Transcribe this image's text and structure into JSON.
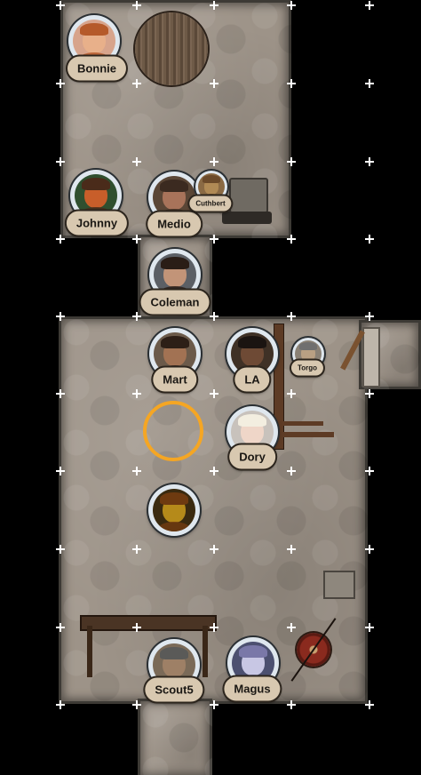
{
  "tokens": [
    {
      "name": "Bonnie",
      "skin": "#e8b08a",
      "hair": "#b55a2a",
      "bg": "#d7a48c"
    },
    {
      "name": "Johnny",
      "skin": "#c85e2a",
      "hair": "#4a2b1a",
      "bg": "#2f4f2f"
    },
    {
      "name": "Medio",
      "skin": "#a8735a",
      "hair": "#3b2a20",
      "bg": "#5a4636"
    },
    {
      "name": "Cuthbert",
      "skin": "#b08a55",
      "hair": "#6b4a2a",
      "bg": "#8a6a44"
    },
    {
      "name": "Coleman",
      "skin": "#c29478",
      "hair": "#2a1d16",
      "bg": "#5b5f65"
    },
    {
      "name": "Mart",
      "skin": "#a27253",
      "hair": "#2d1f17",
      "bg": "#6b5a4a"
    },
    {
      "name": "LA",
      "skin": "#6e4a35",
      "hair": "#1b1411",
      "bg": "#3f3126"
    },
    {
      "name": "Torgo",
      "skin": "#b9a083",
      "hair": "#6f6f6f",
      "bg": "#8a8175"
    },
    {
      "name": "Dory",
      "skin": "#efd6c8",
      "hair": "#f3eee0",
      "bg": "#c8c2bc"
    },
    {
      "name": "Scout5",
      "skin": "#9e8066",
      "hair": "#5a5a58",
      "bg": "#7a6a58"
    },
    {
      "name": "Magus",
      "skin": "#c8c7e4",
      "hair": "#7a78a8",
      "bg": "#4c5070"
    }
  ],
  "unnamed_token": {
    "name": "",
    "skin": "#b58a1a",
    "hair": "#6e3a10",
    "bg": "#3a2a10"
  },
  "ring_color": "#f5a623",
  "grid_color": "#ffffff"
}
